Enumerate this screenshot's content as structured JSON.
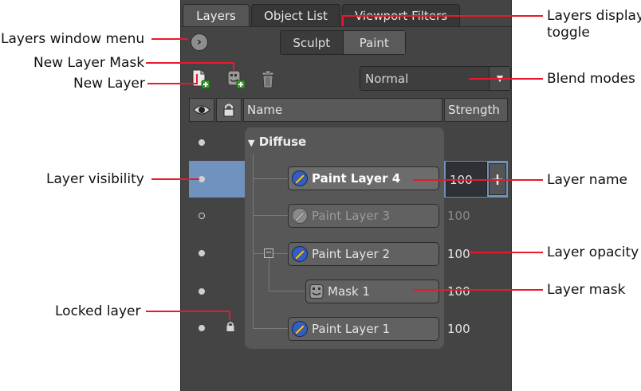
{
  "callouts": {
    "layers_window_menu": "Layers window menu",
    "new_layer_mask": "New Layer Mask",
    "new_layer": "New Layer",
    "layer_visibility": "Layer visibility",
    "locked_layer": "Locked layer",
    "layers_display_toggle_line1": "Layers display",
    "layers_display_toggle_line2": "toggle",
    "blend_modes": "Blend modes",
    "layer_name": "Layer name",
    "layer_opacity": "Layer opacity",
    "layer_mask": "Layer mask"
  },
  "tabs": [
    {
      "label": "Layers",
      "active": true
    },
    {
      "label": "Object List",
      "active": false
    },
    {
      "label": "Viewport Filters",
      "active": false
    }
  ],
  "toggle": {
    "sculpt": "Sculpt",
    "paint": "Paint",
    "active": "Paint"
  },
  "blend_mode": {
    "value": "Normal"
  },
  "header": {
    "name": "Name",
    "strength": "Strength"
  },
  "group": {
    "name": "Diffuse"
  },
  "layers": [
    {
      "name": "Paint Layer 4",
      "strength": "100",
      "selected": true,
      "hidden": false,
      "locked": false
    },
    {
      "name": "Paint Layer 3",
      "strength": "100",
      "selected": false,
      "hidden": true,
      "locked": false
    },
    {
      "name": "Paint Layer 2",
      "strength": "100",
      "selected": false,
      "hidden": false,
      "locked": false
    },
    {
      "name": "Mask 1",
      "strength": "100",
      "selected": false,
      "hidden": false,
      "locked": false,
      "is_mask": true
    },
    {
      "name": "Paint Layer 1",
      "strength": "100",
      "selected": false,
      "hidden": false,
      "locked": true
    }
  ],
  "colors": {
    "callout_line": "#e8192c",
    "selection": "#6f93be",
    "panel": "#444444"
  }
}
